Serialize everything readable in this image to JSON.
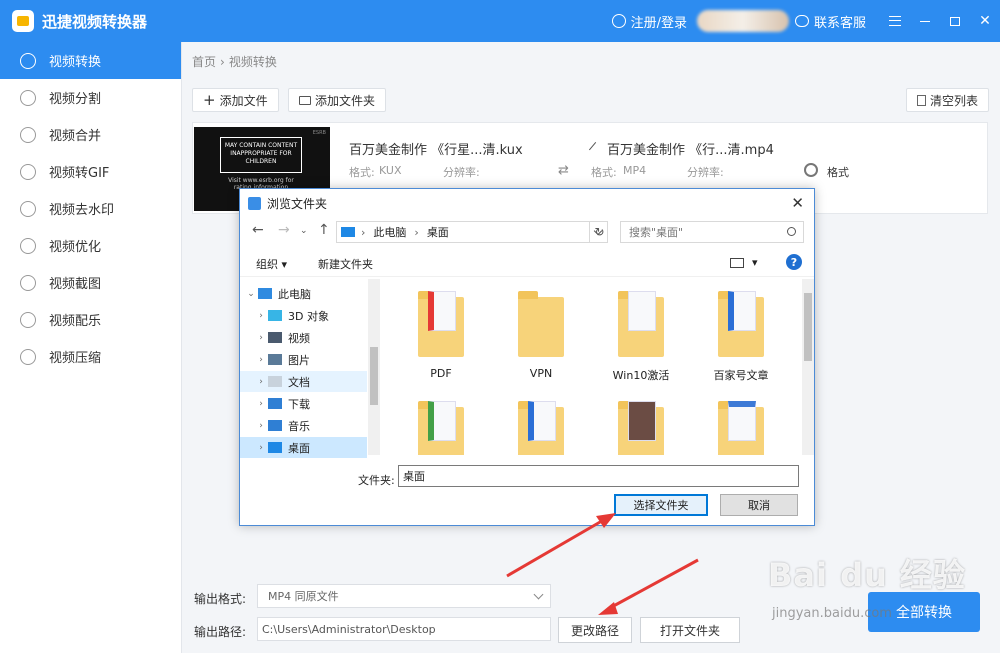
{
  "app": {
    "title": "迅捷视频转换器"
  },
  "header": {
    "login": "注册/登录",
    "service": "联系客服"
  },
  "sidebar": {
    "items": [
      {
        "label": "视频转换",
        "active": true
      },
      {
        "label": "视频分割"
      },
      {
        "label": "视频合并"
      },
      {
        "label": "视频转GIF"
      },
      {
        "label": "视频去水印"
      },
      {
        "label": "视频优化"
      },
      {
        "label": "视频截图"
      },
      {
        "label": "视频配乐"
      },
      {
        "label": "视频压缩"
      }
    ]
  },
  "breadcrumb": {
    "home": "首页",
    "sep": "›",
    "current": "视频转换"
  },
  "toolbar": {
    "add_file": "添加文件",
    "add_folder": "添加文件夹",
    "clear_list": "清空列表"
  },
  "file": {
    "thumb_box": "MAY CONTAIN CONTENT INAPPROPRIATE FOR CHILDREN",
    "thumb_sub": "Visit www.esrb.org for rating information",
    "thumb_tag": "ESRB",
    "src_name": "百万美金制作 《行星...清.kux",
    "src_format_label": "格式:",
    "src_format": "KUX",
    "src_res_label": "分辨率:",
    "dst_name": "百万美金制作 《行...清.mp4",
    "dst_format_label": "格式:",
    "dst_format": "MP4",
    "dst_res_label": "分辨率:",
    "format_btn": "格式"
  },
  "output": {
    "format_label": "输出格式:",
    "format_value": "MP4  同原文件",
    "path_label": "输出路径:",
    "path_value": "C:\\Users\\Administrator\\Desktop",
    "change_path": "更改路径",
    "open_folder": "打开文件夹",
    "convert_all": "全部转换"
  },
  "dialog": {
    "title": "浏览文件夹",
    "address": {
      "root": "此电脑",
      "current": "桌面"
    },
    "search_placeholder": "搜索\"桌面\"",
    "organize": "组织",
    "new_folder": "新建文件夹",
    "tree": [
      {
        "label": "此电脑",
        "level": 0,
        "exp": "⌄"
      },
      {
        "label": "3D 对象",
        "level": 1,
        "exp": "›"
      },
      {
        "label": "视频",
        "level": 1,
        "exp": "›"
      },
      {
        "label": "图片",
        "level": 1,
        "exp": "›"
      },
      {
        "label": "文档",
        "level": 1,
        "exp": "›",
        "hl": true
      },
      {
        "label": "下载",
        "level": 1,
        "exp": "›"
      },
      {
        "label": "音乐",
        "level": 1,
        "exp": "›"
      },
      {
        "label": "桌面",
        "level": 1,
        "exp": "›",
        "sel": true
      }
    ],
    "folders": [
      {
        "label": "PDF"
      },
      {
        "label": "VPN"
      },
      {
        "label": "Win10激活"
      },
      {
        "label": "百家号文章"
      },
      {
        "label": ""
      },
      {
        "label": ""
      },
      {
        "label": ""
      },
      {
        "label": ""
      }
    ],
    "folder_label": "文件夹:",
    "folder_value": "桌面",
    "select_btn": "选择文件夹",
    "cancel_btn": "取消"
  },
  "watermark": {
    "main": "Bai du 经验",
    "sub": "jingyan.baidu.com"
  },
  "colors": {
    "accent": "#2d8cf0",
    "arrow": "#e53935"
  }
}
